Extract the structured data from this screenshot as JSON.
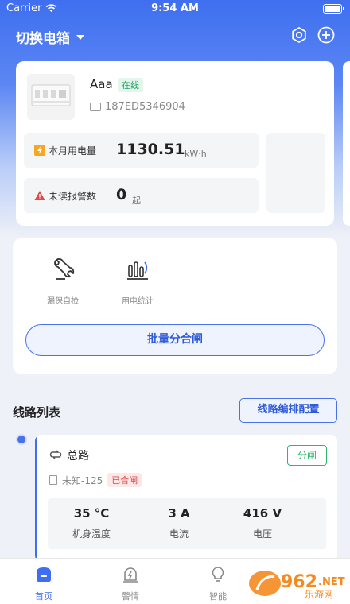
{
  "status_bar": {
    "carrier": "Carrier",
    "time": "9:54 AM"
  },
  "header": {
    "title": "切换电箱",
    "settings_icon": "hex-settings-icon",
    "add_icon": "plus-circle-icon"
  },
  "device": {
    "name": "Aaa",
    "status": "在线",
    "serial": "187ED5346904",
    "energy_label": "本月用电量",
    "energy_value": "1130.51",
    "energy_unit": "kW·h",
    "alarm_label": "未读报警数",
    "alarm_value": "0",
    "alarm_unit": "起"
  },
  "tools": {
    "leak_check_label": "漏保自检",
    "power_stats_label": "用电统计",
    "batch_button": "批量分合闸"
  },
  "lines": {
    "section_title": "线路列表",
    "config_button": "线路编排配置",
    "items": [
      {
        "name": "总路",
        "action": "分闸",
        "model": "未知-125",
        "state": "已合闸",
        "temperature_value": "35 °C",
        "temperature_label": "机身温度",
        "current_value": "3 A",
        "current_label": "电流",
        "voltage_value": "416 V",
        "voltage_label": "电压"
      }
    ]
  },
  "tab_bar": {
    "home": "首页",
    "alarm": "警情",
    "smart": "智能"
  },
  "colors": {
    "primary": "#3f6ff0",
    "online": "#25a56a",
    "alarm": "#e04848",
    "open": "#2fb56f"
  }
}
